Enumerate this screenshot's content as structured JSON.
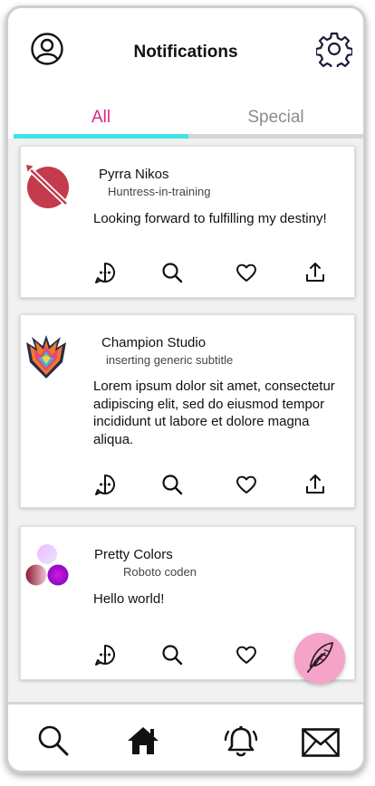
{
  "header": {
    "title": "Notifications",
    "profile_icon": "user-circle-icon",
    "settings_icon": "gear-icon"
  },
  "tabs": [
    {
      "label": "All",
      "active": true
    },
    {
      "label": "Special",
      "active": false
    }
  ],
  "colors": {
    "active_tab": "#d8288b",
    "tab_indicator": "#3fe3e6",
    "fab": "#f5a3c8"
  },
  "posts": [
    {
      "name": "Pyrra Nikos",
      "subtitle": "Huntress-in-training",
      "body": "Looking forward to fulfilling my destiny!",
      "avatar": "red-circle-arrow-logo"
    },
    {
      "name": "Champion Studio",
      "subtitle": "inserting generic subtitle",
      "body": "Lorem ipsum dolor sit amet, consectetur adipiscing elit, sed do eiusmod tempor incididunt ut labore et dolore magna aliqua.",
      "avatar": "winged-crest-logo"
    },
    {
      "name": "Pretty Colors",
      "subtitle": "Roboto coden",
      "body": "Hello world!",
      "avatar": "three-color-circles"
    }
  ],
  "post_actions": [
    "comment-icon",
    "search-icon",
    "heart-icon",
    "share-icon"
  ],
  "fab": {
    "icon": "feather-quill-icon"
  },
  "bottom_nav": [
    "search-icon",
    "home-icon",
    "bell-ringing-icon",
    "mail-icon"
  ]
}
